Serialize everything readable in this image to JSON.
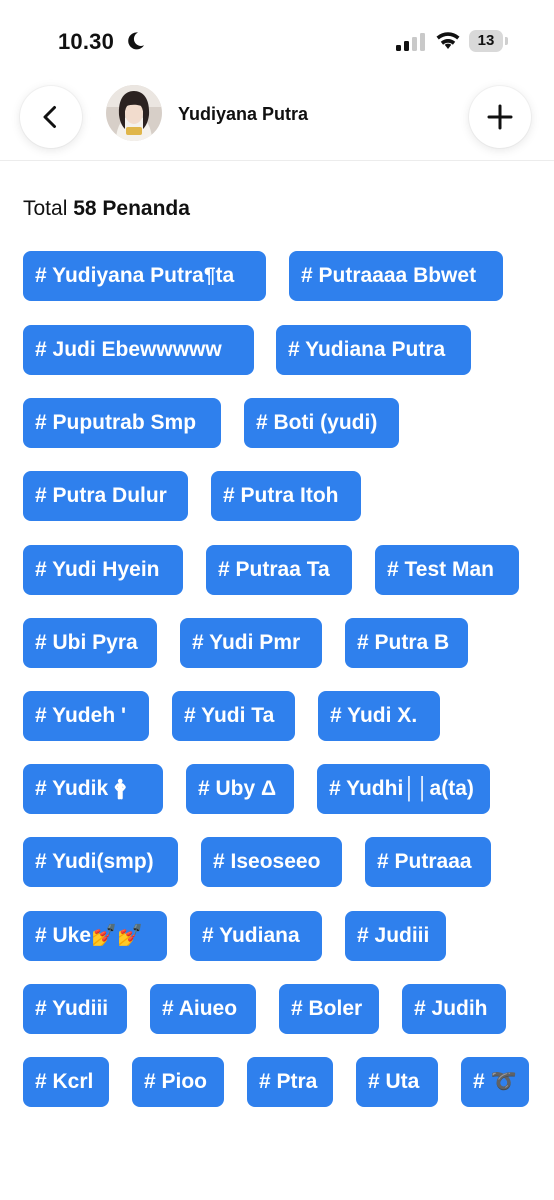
{
  "status_bar": {
    "time": "10.30",
    "battery_level": "13"
  },
  "header": {
    "profile_name": "Yudiyana Putra"
  },
  "summary": {
    "prefix": "Total",
    "count_text": "58 Penanda"
  },
  "tags": [
    "# Yudiyana Putra¶ta",
    "# Putraaaa Bbwet",
    "# Judi Ebewwwww",
    "# Yudiana Putra",
    "# Puputrab Smp",
    "# Boti (yudi)",
    "# Putra Dulur",
    "# Putra Itoh",
    "# Yudi Hyein",
    "# Putraa Ta",
    "# Test Man",
    "# Ubi Pyra",
    "# Yudi Pmr",
    "# Putra B",
    "# Yudeh '",
    "# Yudi Ta",
    "# Yudi X.",
    "# Yudik 🛉",
    "# Uby Δ",
    "# Yudhi││a(ta)",
    "# Yudi(smp)",
    "# Iseoseeo",
    "# Putraaa",
    "# Uke💅💅",
    "# Yudiana",
    "# Judiii",
    "# Yudiii",
    "# Aiueo",
    "# Boler",
    "# Judih",
    "# Kcrl",
    "# Pioo",
    "# Ptra",
    "# Uta",
    "# ➰"
  ]
}
